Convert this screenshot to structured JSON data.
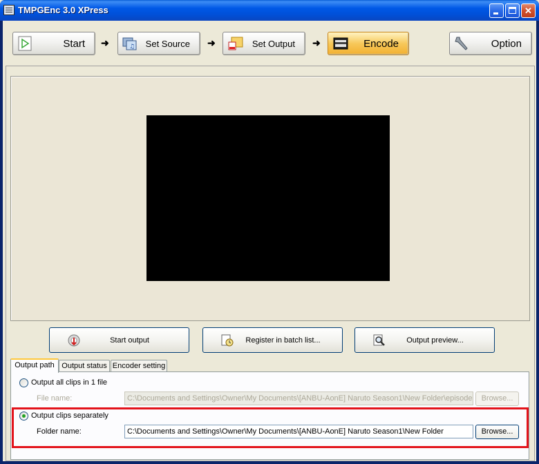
{
  "window": {
    "title": "TMPGEnc 3.0 XPress"
  },
  "steps": {
    "start": "Start",
    "set_source": "Set Source",
    "set_output": "Set Output",
    "encode": "Encode",
    "option": "Option",
    "arrow": "➜"
  },
  "actions": {
    "start_output": "Start output",
    "register_batch": "Register in batch list...",
    "output_preview": "Output preview..."
  },
  "tabs": [
    "Output path",
    "Output status",
    "Encoder setting"
  ],
  "output_path": {
    "all_clips_label": "Output all clips in 1 file",
    "file_name_label": "File name:",
    "file_name_value": "C:\\Documents and Settings\\Owner\\My Documents\\[ANBU-AonE] Naruto Season1\\New Folder\\episode",
    "separately_label": "Output clips separately",
    "folder_name_label": "Folder name:",
    "folder_name_value": "C:\\Documents and Settings\\Owner\\My Documents\\[ANBU-AonE] Naruto Season1\\New Folder",
    "browse_label": "Browse...",
    "selected_option": "Output clips separately"
  },
  "colors": {
    "highlight": "#e3131b",
    "active_step": "#f2b030",
    "titlebar": "#0058e6"
  }
}
